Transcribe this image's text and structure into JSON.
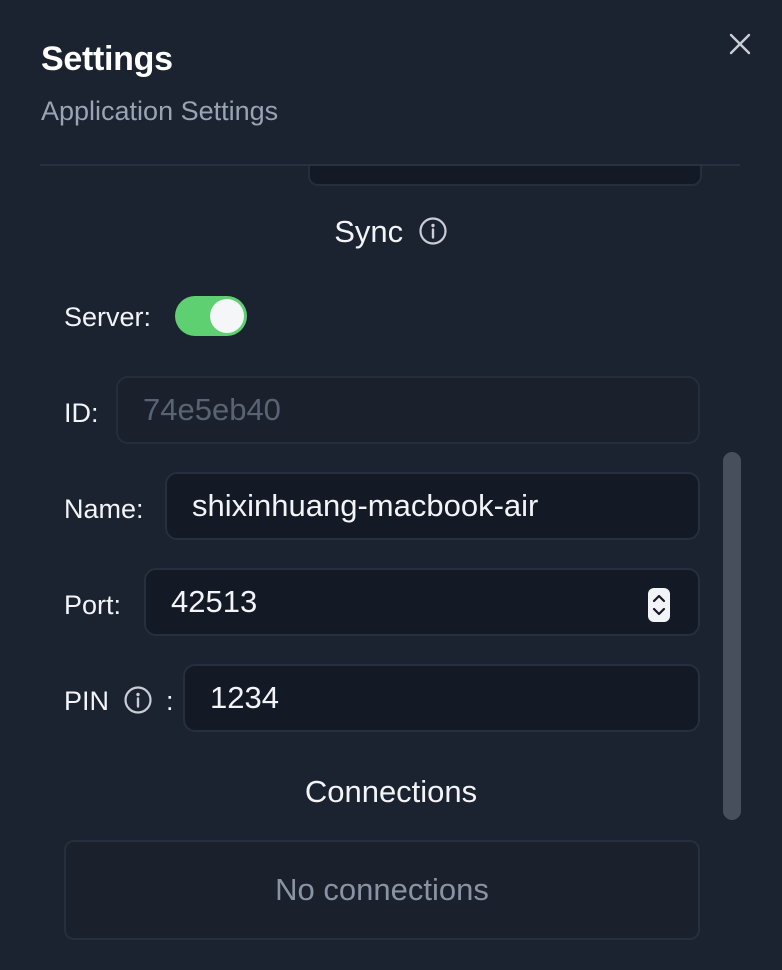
{
  "header": {
    "title": "Settings",
    "subtitle": "Application Settings",
    "close_icon": "close-icon"
  },
  "sync": {
    "title": "Sync",
    "info_icon": "info-icon",
    "server_label": "Server:",
    "server_enabled": true,
    "id_label": "ID:",
    "id_placeholder": "74e5eb40",
    "name_label": "Name:",
    "name_value": "shixinhuang-macbook-air",
    "port_label": "Port:",
    "port_value": "42513",
    "pin_label": "PIN",
    "pin_colon": ":",
    "pin_value": "1234"
  },
  "connections": {
    "title": "Connections",
    "empty_text": "No connections"
  },
  "colors": {
    "background": "#1b2230",
    "field_background": "#131a26",
    "toggle_on": "#5fd072",
    "scrollbar": "#474e5c"
  }
}
